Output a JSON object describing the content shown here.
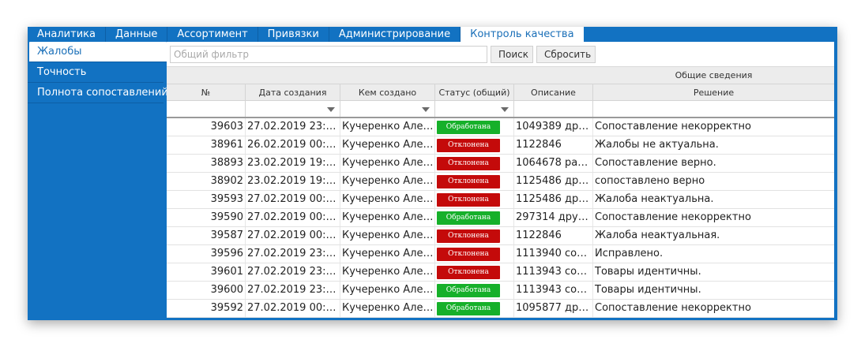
{
  "top_tabs": [
    {
      "label": "Аналитика",
      "active": false
    },
    {
      "label": "Данные",
      "active": false
    },
    {
      "label": "Ассортимент",
      "active": false
    },
    {
      "label": "Привязки",
      "active": false
    },
    {
      "label": "Администрирование",
      "active": false
    },
    {
      "label": "Контроль качества",
      "active": true
    }
  ],
  "sidebar": {
    "items": [
      {
        "label": "Жалобы",
        "active": true
      },
      {
        "label": "Точность",
        "active": false
      },
      {
        "label": "Полнота сопоставлений",
        "active": false
      }
    ]
  },
  "filter": {
    "placeholder": "Общий фильтр",
    "value": "",
    "search_label": "Поиск",
    "reset_label": "Сбросить"
  },
  "grid": {
    "group_header": "Общие сведения",
    "columns": [
      "№",
      "Дата создания",
      "Кем создано",
      "Статус (общий)",
      "Описание",
      "Решение"
    ],
    "rows": [
      {
        "num": "39603",
        "date": "27.02.2019 23:09:...",
        "author": "Кучеренко Алек...",
        "status": "Обработана",
        "status_type": "ok",
        "desc": "1049389 друг...",
        "decision": "Сопоставление некорректно"
      },
      {
        "num": "38961",
        "date": "26.02.2019 00:35:...",
        "author": "Кучеренко Алек...",
        "status": "Отклонена",
        "status_type": "rej",
        "desc": "1122846",
        "decision": "Жалобы не актуальна."
      },
      {
        "num": "38893",
        "date": "23.02.2019 19:39:...",
        "author": "Кучеренко Алек...",
        "status": "Отклонена",
        "status_type": "rej",
        "desc": "1064678 разн...",
        "decision": "Сопоставление верно."
      },
      {
        "num": "38902",
        "date": "23.02.2019 19:39:...",
        "author": "Кучеренко Алек...",
        "status": "Отклонена",
        "status_type": "rej",
        "desc": "1125486 друг...",
        "decision": "сопоставлено верно"
      },
      {
        "num": "39593",
        "date": "27.02.2019 00:28:...",
        "author": "Кучеренко Алек...",
        "status": "Отклонена",
        "status_type": "rej",
        "desc": "1125486 друг...",
        "decision": "Жалоба неактуальна."
      },
      {
        "num": "39590",
        "date": "27.02.2019 00:28:...",
        "author": "Кучеренко Алек...",
        "status": "Обработана",
        "status_type": "ok",
        "desc": "297314 друго...",
        "decision": "Сопоставление некорректно"
      },
      {
        "num": "39587",
        "date": "27.02.2019 00:28:...",
        "author": "Кучеренко Алек...",
        "status": "Отклонена",
        "status_type": "rej",
        "desc": "1122846",
        "decision": "Жалоба неактуальная."
      },
      {
        "num": "39596",
        "date": "27.02.2019 23:09:...",
        "author": "Кучеренко Алек...",
        "status": "Отклонена",
        "status_type": "rej",
        "desc": "1113940 сове...",
        "decision": "Исправлено."
      },
      {
        "num": "39601",
        "date": "27.02.2019 23:09:...",
        "author": "Кучеренко Алек...",
        "status": "Отклонена",
        "status_type": "rej",
        "desc": "1113943 сове...",
        "decision": "Товары идентичны."
      },
      {
        "num": "39600",
        "date": "27.02.2019 23:09:...",
        "author": "Кучеренко Алек...",
        "status": "Обработана",
        "status_type": "ok",
        "desc": "1113943 сове...",
        "decision": "Товары идентичны."
      },
      {
        "num": "39592",
        "date": "27.02.2019 00:28:...",
        "author": "Кучеренко Алек...",
        "status": "Обработана",
        "status_type": "ok",
        "desc": "1095877 друг...",
        "decision": "Сопоставление некорректно"
      }
    ]
  },
  "colors": {
    "brand_blue": "#1272c2",
    "status_ok": "#16b02a",
    "status_rejected": "#c40a0a"
  }
}
